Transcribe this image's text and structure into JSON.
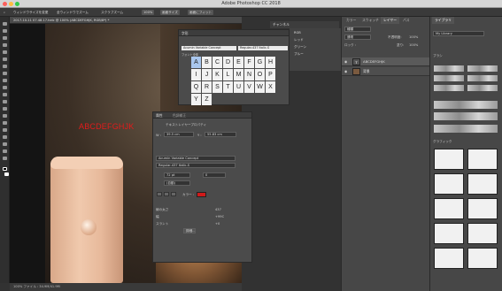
{
  "window": {
    "title": "Adobe Photoshop CC 2018"
  },
  "options_bar": {
    "items": [
      "ウィンドウサイズを変更",
      "全ウィンドウでズーム",
      "スクラブズーム",
      "100%",
      "画面サイズ",
      "画面にフィット"
    ]
  },
  "document": {
    "tab_label": "2017-10-11 07.48.17.heic @ 100% (ABCDEFGHJK, RGB/8*) *",
    "canvas_text": "ABCDEFGHJK",
    "status_text": "100%   ファイル : 34.9M/41.9M"
  },
  "glyphs_panel": {
    "title": "字形",
    "font": "Acumin Variable Concept",
    "style": "Regular-437 Italic-S",
    "filter": "フォント全体",
    "rows": [
      [
        "A",
        "B",
        "C",
        "D",
        "E",
        "F",
        "G",
        "H"
      ],
      [
        "I",
        "J",
        "K",
        "L",
        "M",
        "N",
        "O",
        "P"
      ],
      [
        "Q",
        "R",
        "S",
        "T",
        "U",
        "V",
        "W",
        "X"
      ],
      [
        "Y",
        "Z"
      ]
    ]
  },
  "properties_panel": {
    "tabs": [
      "属性",
      "色調補正"
    ],
    "section": "テキストレイヤープロパティ",
    "w_label": "W :",
    "w_value": "39.5 cm",
    "h_label": "Y :",
    "h_value": "55.83 cm",
    "font": "Acumin Variable Concept",
    "style": "Regular-437 Italic-S",
    "size": "72 pt",
    "tracking": "0",
    "leading": "(自動)",
    "color_label": "カラー :",
    "width_label": "線の太さ",
    "width_value": "437",
    "slant_label": "幅",
    "slant_value": "+99C",
    "italic_label": "スラント",
    "italic_value": "+0",
    "button": "詳細..."
  },
  "channels_panel": {
    "title": "チャンネル",
    "rows": [
      "RGB",
      "レッド",
      "グリーン",
      "ブルー"
    ]
  },
  "layers_panel": {
    "tabs": [
      "カラー",
      "スウォッチ",
      "レイヤー",
      "パス"
    ],
    "kind": "種類",
    "blend": "通常",
    "opacity_label": "不透明度:",
    "opacity_value": "100%",
    "lock_label": "ロック :",
    "fill_label": "塗り:",
    "fill_value": "100%",
    "layers": [
      {
        "name": "ABCDEFGHJK",
        "type": "T"
      },
      {
        "name": "背景",
        "type": "img"
      }
    ]
  },
  "libraries_panel": {
    "title": "ライブラリ",
    "library": "My Library",
    "section1": "ブラシ",
    "section2": "グラフィック"
  },
  "colors": {
    "accent": "#d01a1a",
    "selection": "#a9c7ee"
  }
}
